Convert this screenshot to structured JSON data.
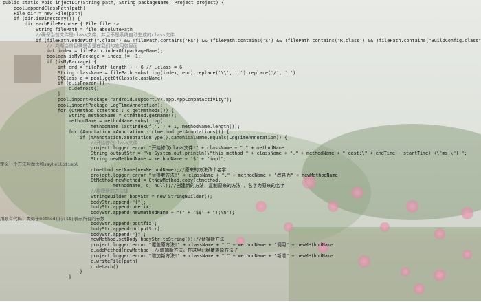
{
  "code_lines": [
    {
      "indent": 0,
      "text": "public static void injectDir(String path, String packageName, Project project) {"
    },
    {
      "indent": 1,
      "text": "pool.appendClassPath(path)"
    },
    {
      "indent": 1,
      "text": "File dir = new File(path)"
    },
    {
      "indent": 1,
      "text": "if (dir.isDirectory()) {"
    },
    {
      "indent": 2,
      "text": "dir.eachFileRecurse { File file ->"
    },
    {
      "indent": 3,
      "text": "String filePath = file.absolutePath"
    },
    {
      "indent": 3,
      "text": "//确保当前文件是class文件，并且不是系统自动生成的class文件"
    },
    {
      "indent": 3,
      "text": "if (filePath.endsWith(\".class\") && !filePath.contains('R$') && !filePath.contains('$') && !filePath.contains('R.class') && !filePath.contains(\"BuildConfig.class\")) {"
    },
    {
      "indent": 4,
      "text": "// 判断当前目录是否是在我们的应用包里面"
    },
    {
      "indent": 4,
      "text": "int index = filePath.indexOf(packageName);"
    },
    {
      "indent": 4,
      "text": "boolean isMyPackage = index != -1;"
    },
    {
      "indent": 4,
      "text": "if (isMyPackage) {"
    },
    {
      "indent": 5,
      "text": "int end = filePath.length() - 6 // .class = 6"
    },
    {
      "indent": 5,
      "text": "String className = filePath.substring(index, end).replace('\\\\', '.').replace('/', '.')"
    },
    {
      "indent": 5,
      "text": "CtClass c = pool.getCtClass(className)"
    },
    {
      "indent": 5,
      "text": "if (c.isFrozen()) {"
    },
    {
      "indent": 6,
      "text": "c.defrost()"
    },
    {
      "indent": 5,
      "text": "}"
    },
    {
      "indent": 5,
      "text": "pool.importPackage(\"android.support.v7.app.AppCompatActivity\");"
    },
    {
      "indent": 5,
      "text": "pool.importPackage(LogTimeAnnotation);"
    },
    {
      "indent": 5,
      "text": "for (CtMethod ctmethod : c.getMethods()) {"
    },
    {
      "indent": 6,
      "text": "String methodName = ctmethod.getName();"
    },
    {
      "indent": 6,
      "text": "methodName = methodName.substring("
    },
    {
      "indent": 8,
      "text": "methodName.lastIndexOf('.') + 1, methodName.length());"
    },
    {
      "indent": 6,
      "text": "for (Annotation mAnnotation : ctmethod.getAnnotations()) {"
    },
    {
      "indent": 7,
      "text": "if (mAnnotation.annotationType().canonicalName.equals(LogTimeAnnotation)) {"
    },
    {
      "indent": 8,
      "text": "//开始修改class文件"
    },
    {
      "indent": 8,
      "text": "project.logger.error \"开始修改class文件!\" + className + \".\" + methodName"
    },
    {
      "indent": 8,
      "text": "String outputStr = \"\\n System.out.println(\\\"this method \" + className + \".\" + methodName + \" cost:\\\" +(endTime - startTime) +\\\"ms.\\\");\";"
    },
    {
      "indent": 8,
      "text": "String newMethodName = methodName + '$' + \"impl\";"
    },
    {
      "indent": 0,
      "text": ""
    },
    {
      "indent": 8,
      "text": "ctmethod.setName(newMethodName);//原来的方法改个名字"
    },
    {
      "indent": 8,
      "text": "project.logger.error \"替换老方法!\" + className + \".\" + methodName + \"改名为\" + newMethodName"
    },
    {
      "indent": 8,
      "text": "CtMethod newMethod = CtNewMethod.copy(ctmethod,"
    },
    {
      "indent": 10,
      "text": "methodName, c, null);//创建新的方法，复制原来的方法 ，名字为原来的名字"
    },
    {
      "indent": 8,
      "text": "//构建新的方法体"
    },
    {
      "indent": 8,
      "text": "StringBuilder bodyStr = new StringBuilder();"
    },
    {
      "indent": 8,
      "text": "bodyStr.append(\"{\");"
    },
    {
      "indent": 8,
      "text": "bodyStr.append(prefix);"
    },
    {
      "indent": 8,
      "text": "bodyStr.append(newMethodName + \"(\" + '$$' + \");\\n\");"
    },
    {
      "indent": 0,
      "text": ""
    },
    {
      "indent": 8,
      "text": "bodyStr.append(postfix);"
    },
    {
      "indent": 8,
      "text": "bodyStr.append(outputStr);"
    },
    {
      "indent": 8,
      "text": "bodyStr.append(\"}\");"
    },
    {
      "indent": 8,
      "text": "newMethod.setBody(bodyStr.toString());//替换新方法"
    },
    {
      "indent": 8,
      "text": "project.logger.error \"覆盖原方法!\" + className + \".\" + methodName + \"调用\" + newMethodName"
    },
    {
      "indent": 8,
      "text": "c.addMethod(newMethod);//增加新方法，在这里已经覆盖原方法了"
    },
    {
      "indent": 8,
      "text": "project.logger.error \"增加新方法!\" + className + \".\" + methodName + \"新增\" + newMethodName"
    },
    {
      "indent": 8,
      "text": "c.writeFile(path)"
    },
    {
      "indent": 8,
      "text": "c.detach()"
    },
    {
      "indent": 7,
      "text": "}"
    },
    {
      "indent": 6,
      "text": "}"
    }
  ],
  "side_comments": [
    {
      "line": 30,
      "text": "定义一个方法叫做比如sayHello$impl"
    },
    {
      "line": 40,
      "text": "用原有代码，类似于method();($$)表示所有的参数"
    }
  ]
}
